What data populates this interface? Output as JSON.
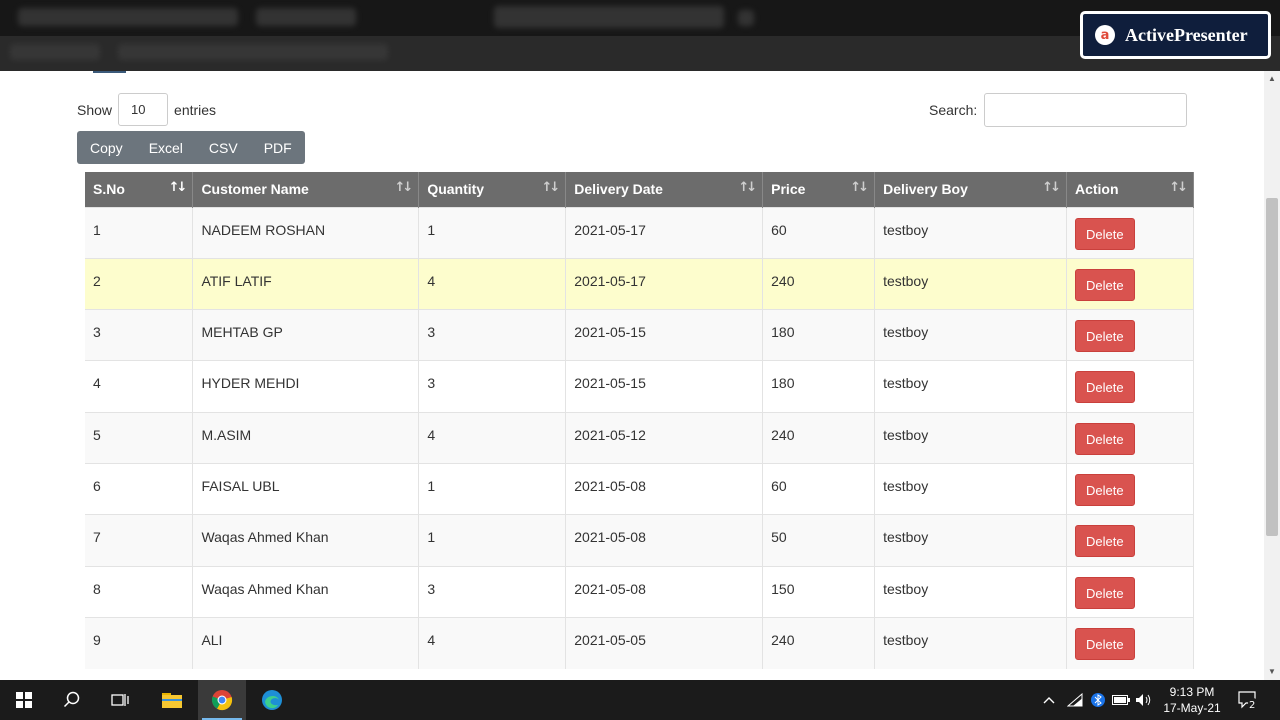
{
  "overlay": {
    "brand": "ActivePresenter",
    "logo_glyph": "a"
  },
  "controls": {
    "show_label": "Show",
    "entries_value": "10",
    "entries_label": "entries",
    "search_label": "Search:",
    "search_value": ""
  },
  "export_buttons": [
    "Copy",
    "Excel",
    "CSV",
    "PDF"
  ],
  "table": {
    "columns": [
      "S.No",
      "Customer Name",
      "Quantity",
      "Delivery Date",
      "Price",
      "Delivery Boy",
      "Action"
    ],
    "rows": [
      {
        "sno": "1",
        "customer": "NADEEM ROSHAN",
        "quantity": "1",
        "date": "2021-05-17",
        "price": "60",
        "boy": "testboy",
        "action": "Delete"
      },
      {
        "sno": "2",
        "customer": "ATIF LATIF",
        "quantity": "4",
        "date": "2021-05-17",
        "price": "240",
        "boy": "testboy",
        "action": "Delete"
      },
      {
        "sno": "3",
        "customer": "MEHTAB GP",
        "quantity": "3",
        "date": "2021-05-15",
        "price": "180",
        "boy": "testboy",
        "action": "Delete"
      },
      {
        "sno": "4",
        "customer": "HYDER MEHDI",
        "quantity": "3",
        "date": "2021-05-15",
        "price": "180",
        "boy": "testboy",
        "action": "Delete"
      },
      {
        "sno": "5",
        "customer": "M.ASIM",
        "quantity": "4",
        "date": "2021-05-12",
        "price": "240",
        "boy": "testboy",
        "action": "Delete"
      },
      {
        "sno": "6",
        "customer": "FAISAL UBL",
        "quantity": "1",
        "date": "2021-05-08",
        "price": "60",
        "boy": "testboy",
        "action": "Delete"
      },
      {
        "sno": "7",
        "customer": "Waqas Ahmed Khan",
        "quantity": "1",
        "date": "2021-05-08",
        "price": "50",
        "boy": "testboy",
        "action": "Delete"
      },
      {
        "sno": "8",
        "customer": "Waqas Ahmed Khan",
        "quantity": "3",
        "date": "2021-05-08",
        "price": "150",
        "boy": "testboy",
        "action": "Delete"
      },
      {
        "sno": "9",
        "customer": "ALI",
        "quantity": "4",
        "date": "2021-05-05",
        "price": "240",
        "boy": "testboy",
        "action": "Delete"
      }
    ],
    "highlighted_row": "2"
  },
  "taskbar": {
    "time": "9:13 PM",
    "date": "17-May-21",
    "notification_count": "2"
  },
  "colors": {
    "header_bg": "#6c6c6c",
    "highlight_row": "#fdfdcd",
    "delete_button": "#d9534f",
    "export_group": "#6c757d"
  }
}
